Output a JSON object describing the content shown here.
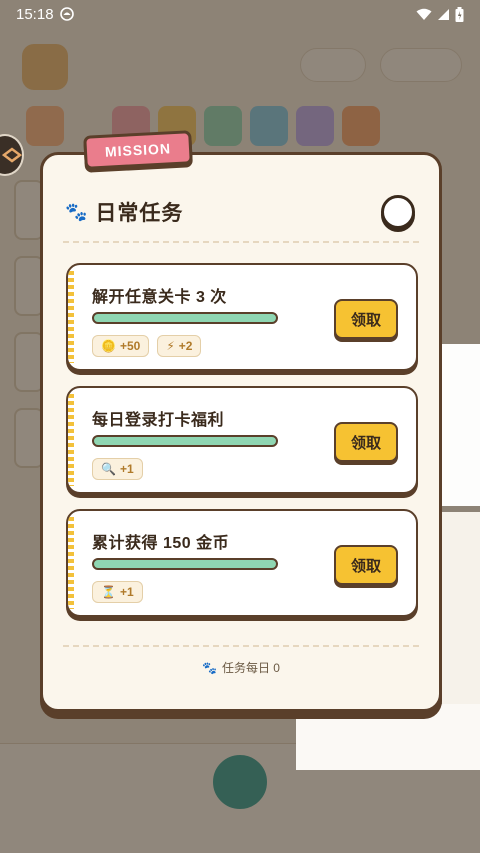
{
  "status_bar": {
    "time": "15:18",
    "notification_icon": "app-notification-icon",
    "wifi_icon": "wifi-icon",
    "signal_icon": "signal-icon",
    "battery_icon": "battery-icon"
  },
  "modal": {
    "tag": "MISSION",
    "title": "日常任务",
    "title_icon": "paw-icon",
    "close_icon": "close-circle-icon",
    "footer": "任务每日 0",
    "footer_icon": "paw-icon"
  },
  "tasks": [
    {
      "name": "解开任意关卡 3 次",
      "claim_label": "领取",
      "rewards": [
        {
          "icon": "coin-icon",
          "glyph": "🪙",
          "text": "+50"
        },
        {
          "icon": "lightning-icon",
          "glyph": "⚡",
          "text": "+2"
        }
      ]
    },
    {
      "name": "每日登录打卡福利",
      "claim_label": "领取",
      "rewards": [
        {
          "icon": "magnifier-icon",
          "glyph": "🔍",
          "text": "+1"
        }
      ]
    },
    {
      "name": "累计获得 150 金币",
      "claim_label": "领取",
      "rewards": [
        {
          "icon": "hourglass-icon",
          "glyph": "⏳",
          "text": "+1"
        }
      ]
    }
  ],
  "colors": {
    "accent_yellow": "#f6c232",
    "progress_green": "#8fd6b2",
    "border_brown": "#5a3f2a",
    "mission_pink": "#ea7d8c",
    "panel_cream": "#fbf6ec"
  }
}
